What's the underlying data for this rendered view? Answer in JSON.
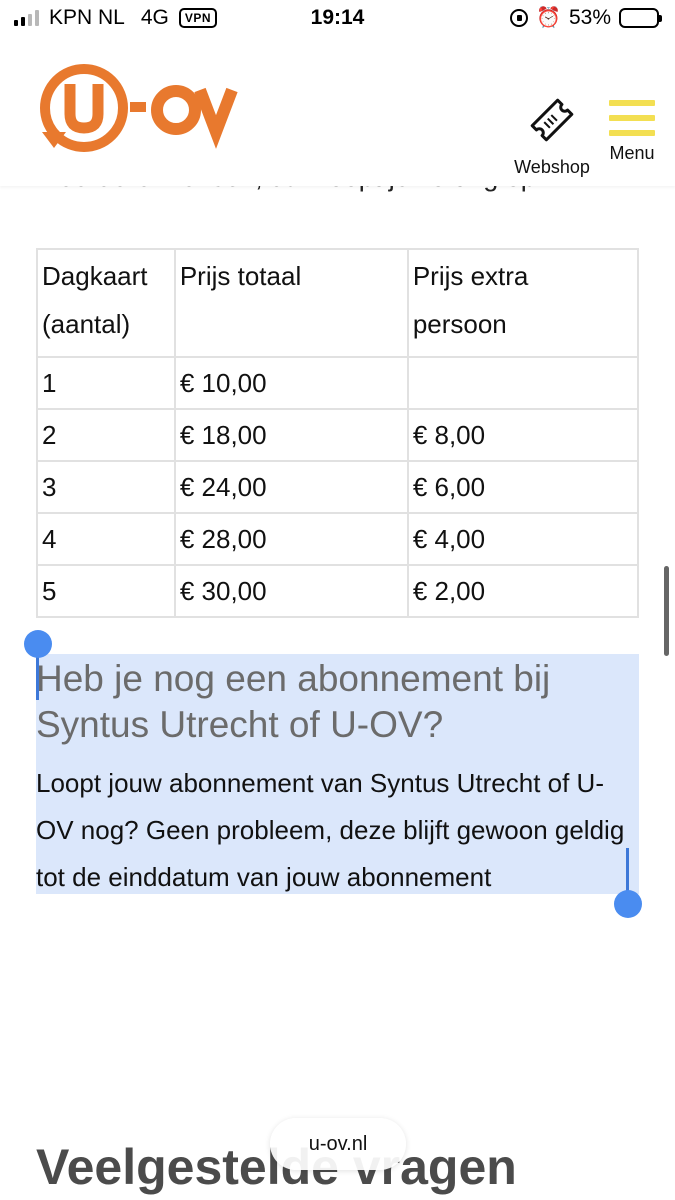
{
  "status_bar": {
    "carrier": "KPN NL",
    "network": "4G",
    "vpn": "VPN",
    "time": "19:14",
    "battery": "53%",
    "battery_level": 0.53
  },
  "header": {
    "logo_text": "U-OV",
    "logo_u": "U",
    "logo_ov": "OV",
    "webshop_label": "Webshop",
    "menu_label": "Menu"
  },
  "clipped_line": "meerdere mensen, dan loopt je korting op.",
  "table": {
    "headers": [
      "Dagkaart (aantal)",
      "Prijs totaal",
      "Prijs extra persoon"
    ],
    "rows": [
      [
        "1",
        "€ 10,00",
        ""
      ],
      [
        "2",
        "€ 18,00",
        "€ 8,00"
      ],
      [
        "3",
        "€ 24,00",
        "€ 6,00"
      ],
      [
        "4",
        "€ 28,00",
        "€ 4,00"
      ],
      [
        "5",
        "€ 30,00",
        "€ 2,00"
      ]
    ]
  },
  "section": {
    "heading": "Heb je nog een abonnement bij Syntus Utrecht of U-OV?",
    "paragraph": "Loopt jouw abonnement van Syntus Utrecht of U-OV nog?  Geen probleem, deze blijft gewoon geldig tot de einddatum van jouw abonnement"
  },
  "faq_title": "Veelgestelde vragen",
  "url": "u-ov.nl",
  "colors": {
    "brand_orange": "#e8792e",
    "menu_yellow": "#f3df52",
    "selection": "#dbe7fb",
    "handle_blue": "#4a8cf0"
  }
}
